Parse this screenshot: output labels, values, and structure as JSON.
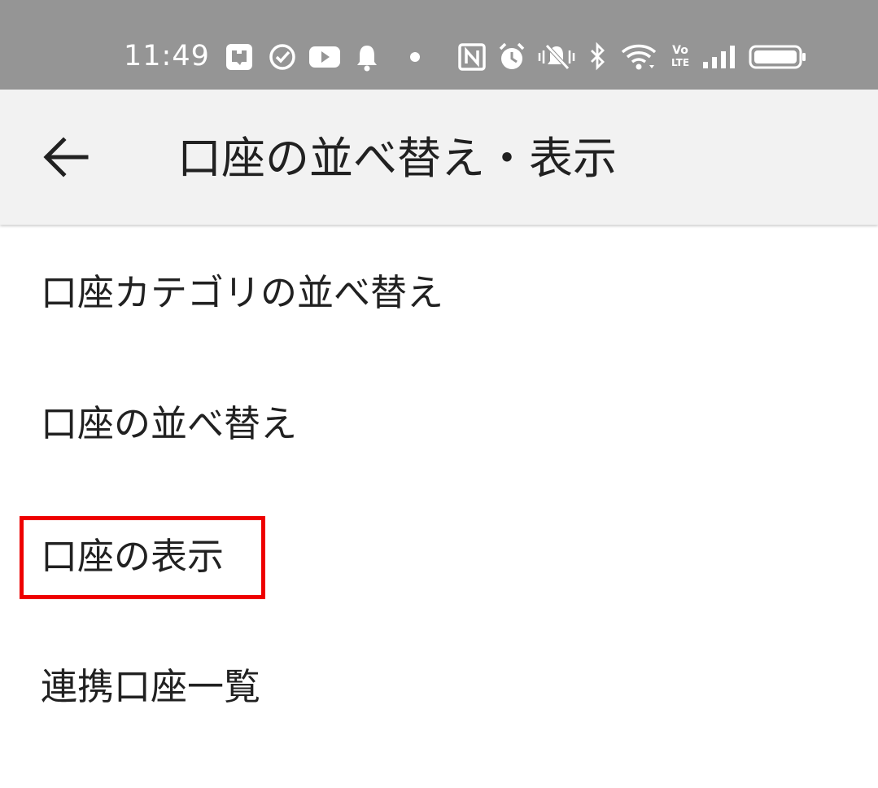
{
  "status_bar": {
    "time": "11:49",
    "icons": [
      "app-notification-icon",
      "check-circle-icon",
      "youtube-icon",
      "bell-icon",
      "dot-icon",
      "nfc-icon",
      "alarm-icon",
      "vibrate-off-icon",
      "bluetooth-icon",
      "wifi-icon",
      "volte-icon",
      "signal-icon",
      "battery-icon"
    ],
    "volte_line1": "Vo",
    "volte_line2": "LTE"
  },
  "app_bar": {
    "back_icon": "arrow-back-icon",
    "title": "口座の並べ替え・表示"
  },
  "menu": {
    "items": [
      {
        "label": "口座カテゴリの並べ替え"
      },
      {
        "label": "口座の並べ替え"
      },
      {
        "label": "口座の表示",
        "highlighted": true
      },
      {
        "label": "連携口座一覧"
      }
    ]
  },
  "colors": {
    "status_bar_bg": "#959595",
    "app_bar_bg": "#f2f2f2",
    "text": "#212121",
    "highlight": "#ee0000"
  }
}
